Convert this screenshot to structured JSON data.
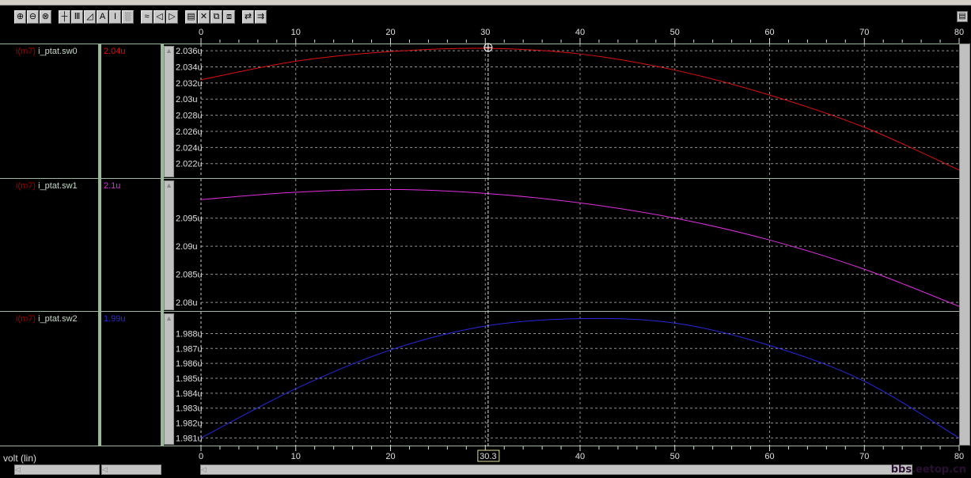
{
  "toolbar": {
    "buttons": [
      {
        "icon": "zoom-in-icon",
        "glyph": "⊕"
      },
      {
        "icon": "zoom-out-icon",
        "glyph": "⊖"
      },
      {
        "icon": "zoom-fit-icon",
        "glyph": "⊗"
      },
      {
        "icon": "crosshair-icon",
        "glyph": "┼"
      },
      {
        "icon": "vertical-lines-icon",
        "glyph": "Ⅲ"
      },
      {
        "icon": "slope-icon",
        "glyph": "◿"
      },
      {
        "icon": "label-icon",
        "glyph": "A"
      },
      {
        "icon": "delta-marker-icon",
        "glyph": "I"
      },
      {
        "icon": "grid-icon",
        "glyph": "░"
      },
      {
        "icon": "wave-icon",
        "glyph": "≈"
      },
      {
        "icon": "pan-left-icon",
        "glyph": "◁"
      },
      {
        "icon": "pan-right-icon",
        "glyph": "▷"
      },
      {
        "icon": "panel-icon",
        "glyph": "▤"
      },
      {
        "icon": "delete-icon",
        "glyph": "✕"
      },
      {
        "icon": "stack-icon",
        "glyph": "⧉"
      },
      {
        "icon": "overlay-icon",
        "glyph": "⧈"
      },
      {
        "icon": "swap-icon",
        "glyph": "⇄"
      },
      {
        "icon": "export-icon",
        "glyph": "⇉"
      }
    ]
  },
  "x_axis": {
    "label": "volt (lin)",
    "ticks": [
      0,
      10,
      20,
      30,
      40,
      50,
      60,
      70,
      80
    ],
    "range": [
      0,
      80
    ],
    "cursor_value": "30.3",
    "cursor": 30.3
  },
  "colors": {
    "red": "#e01010",
    "magenta": "#e030e0",
    "blue": "#2828e0",
    "grid": "#909090"
  },
  "panels": [
    {
      "fn": "i(m7)",
      "name": "i_ptat.sw0",
      "value": "2.04u",
      "color": "#e01010",
      "ylim": [
        2.0205,
        2.0366
      ],
      "yticks": [
        2.036,
        2.034,
        2.032,
        2.03,
        2.028,
        2.026,
        2.024,
        2.022
      ],
      "ytick_labels": [
        "2.036u",
        "2.034u",
        "2.032u",
        "2.03u",
        "2.028u",
        "2.026u",
        "2.024u",
        "2.022u"
      ],
      "x": [
        0,
        10,
        20,
        30,
        40,
        50,
        60,
        70,
        80
      ],
      "y": [
        2.0324,
        2.0347,
        2.0359,
        2.0363,
        2.0356,
        2.0336,
        2.0305,
        2.0265,
        2.0212
      ]
    },
    {
      "fn": "i(m7)",
      "name": "i_ptat.sw1",
      "value": "2.1u",
      "color": "#e030e0",
      "ylim": [
        2.0789,
        2.1017
      ],
      "yticks": [
        2.095,
        2.09,
        2.085,
        2.08
      ],
      "ytick_labels": [
        "2.095u",
        "2.09u",
        "2.085u",
        "2.08u"
      ],
      "x": [
        0,
        10,
        20,
        30,
        40,
        50,
        60,
        70,
        80
      ],
      "y": [
        2.0983,
        2.0996,
        2.1001,
        2.0994,
        2.0977,
        2.095,
        2.0911,
        2.0859,
        2.0793
      ]
    },
    {
      "fn": "i(m7)",
      "name": "i_ptat.sw2",
      "value": "1.99u",
      "color": "#2828e0",
      "ylim": [
        1.98065,
        1.98935
      ],
      "yticks": [
        1.988,
        1.987,
        1.986,
        1.985,
        1.984,
        1.983,
        1.982,
        1.981
      ],
      "ytick_labels": [
        "1.988u",
        "1.987u",
        "1.986u",
        "1.985u",
        "1.984u",
        "1.983u",
        "1.982u",
        "1.981u"
      ],
      "x": [
        0,
        10,
        20,
        30,
        40,
        50,
        60,
        70,
        80
      ],
      "y": [
        1.981,
        1.9843,
        1.9869,
        1.9885,
        1.989,
        1.9887,
        1.9872,
        1.9848,
        1.981
      ]
    }
  ],
  "watermark": "bbs.eetop.cn"
}
